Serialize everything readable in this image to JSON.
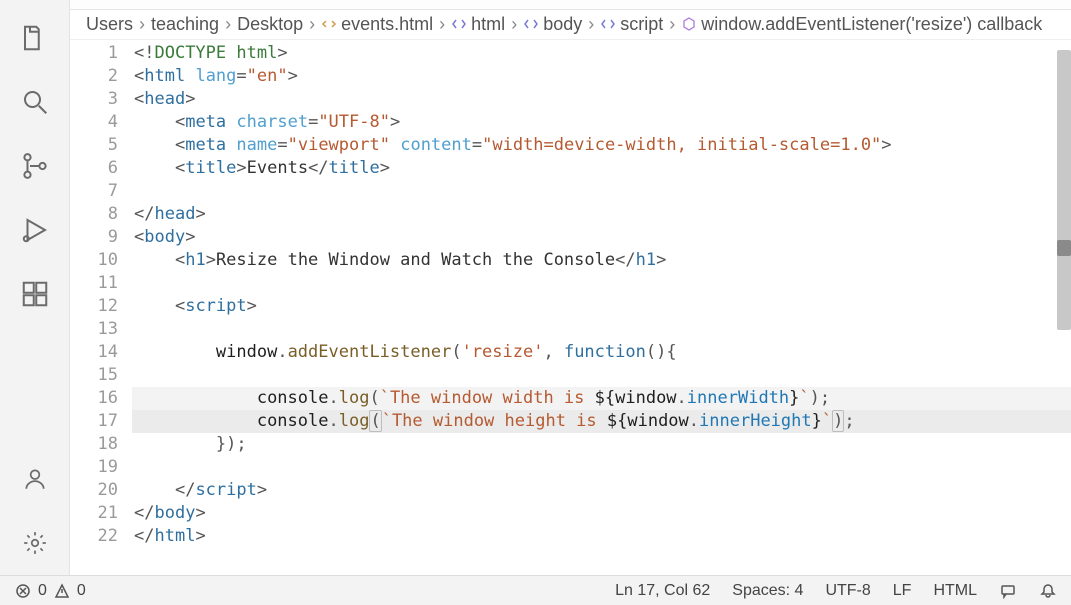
{
  "activity": {
    "icons": [
      "files",
      "search",
      "source-control",
      "run-debug",
      "extensions",
      "account",
      "settings-gear"
    ]
  },
  "breadcrumbs": {
    "items": [
      {
        "label": "Users",
        "icon": null
      },
      {
        "label": "teaching",
        "icon": null
      },
      {
        "label": "Desktop",
        "icon": null
      },
      {
        "label": "events.html",
        "icon": "file-code"
      },
      {
        "label": "html",
        "icon": "symbol"
      },
      {
        "label": "body",
        "icon": "symbol"
      },
      {
        "label": "script",
        "icon": "symbol"
      },
      {
        "label": "window.addEventListener('resize') callback",
        "icon": "symbol-cube"
      }
    ]
  },
  "code": {
    "highlight_line": 17,
    "also_highlight": [
      16
    ],
    "lines": [
      {
        "n": 1,
        "ind": 0,
        "seg": [
          [
            "punc",
            "<!"
          ],
          [
            "doctype",
            "DOCTYPE html"
          ],
          [
            "punc",
            ">"
          ]
        ]
      },
      {
        "n": 2,
        "ind": 0,
        "seg": [
          [
            "punc",
            "<"
          ],
          [
            "tag",
            "html"
          ],
          [
            "text",
            " "
          ],
          [
            "attr",
            "lang"
          ],
          [
            "punc",
            "="
          ],
          [
            "str",
            "\"en\""
          ],
          [
            "punc",
            ">"
          ]
        ]
      },
      {
        "n": 3,
        "ind": 0,
        "seg": [
          [
            "punc",
            "<"
          ],
          [
            "tag",
            "head"
          ],
          [
            "punc",
            ">"
          ]
        ]
      },
      {
        "n": 4,
        "ind": 1,
        "seg": [
          [
            "punc",
            "<"
          ],
          [
            "tag",
            "meta"
          ],
          [
            "text",
            " "
          ],
          [
            "attr",
            "charset"
          ],
          [
            "punc",
            "="
          ],
          [
            "str",
            "\"UTF-8\""
          ],
          [
            "punc",
            ">"
          ]
        ]
      },
      {
        "n": 5,
        "ind": 1,
        "seg": [
          [
            "punc",
            "<"
          ],
          [
            "tag",
            "meta"
          ],
          [
            "text",
            " "
          ],
          [
            "attr",
            "name"
          ],
          [
            "punc",
            "="
          ],
          [
            "str",
            "\"viewport\""
          ],
          [
            "text",
            " "
          ],
          [
            "attr",
            "content"
          ],
          [
            "punc",
            "="
          ],
          [
            "str",
            "\"width=device-width, initial-scale=1.0\""
          ],
          [
            "punc",
            ">"
          ]
        ]
      },
      {
        "n": 6,
        "ind": 1,
        "seg": [
          [
            "punc",
            "<"
          ],
          [
            "tag",
            "title"
          ],
          [
            "punc",
            ">"
          ],
          [
            "text",
            "Events"
          ],
          [
            "punc",
            "</"
          ],
          [
            "tag",
            "title"
          ],
          [
            "punc",
            ">"
          ]
        ]
      },
      {
        "n": 7,
        "ind": 0,
        "seg": []
      },
      {
        "n": 8,
        "ind": 0,
        "seg": [
          [
            "punc",
            "</"
          ],
          [
            "tag",
            "head"
          ],
          [
            "punc",
            ">"
          ]
        ]
      },
      {
        "n": 9,
        "ind": 0,
        "seg": [
          [
            "punc",
            "<"
          ],
          [
            "tag",
            "body"
          ],
          [
            "punc",
            ">"
          ]
        ]
      },
      {
        "n": 10,
        "ind": 1,
        "seg": [
          [
            "punc",
            "<"
          ],
          [
            "tag",
            "h1"
          ],
          [
            "punc",
            ">"
          ],
          [
            "text",
            "Resize the Window and Watch the Console"
          ],
          [
            "punc",
            "</"
          ],
          [
            "tag",
            "h1"
          ],
          [
            "punc",
            ">"
          ]
        ]
      },
      {
        "n": 11,
        "ind": 0,
        "seg": []
      },
      {
        "n": 12,
        "ind": 1,
        "seg": [
          [
            "punc",
            "<"
          ],
          [
            "tag",
            "script"
          ],
          [
            "punc",
            ">"
          ]
        ]
      },
      {
        "n": 13,
        "ind": 0,
        "seg": []
      },
      {
        "n": 14,
        "ind": 2,
        "seg": [
          [
            "ident",
            "window"
          ],
          [
            "punc",
            "."
          ],
          [
            "func",
            "addEventListener"
          ],
          [
            "punc",
            "("
          ],
          [
            "kw-resize",
            "'resize'"
          ],
          [
            "punc",
            ", "
          ],
          [
            "kw",
            "function"
          ],
          [
            "punc",
            "(){"
          ]
        ]
      },
      {
        "n": 15,
        "ind": 0,
        "seg": []
      },
      {
        "n": 16,
        "ind": 3,
        "seg": [
          [
            "ident",
            "console"
          ],
          [
            "punc",
            "."
          ],
          [
            "func",
            "log"
          ],
          [
            "punc",
            "("
          ],
          [
            "tmpl",
            "`The window width is "
          ],
          [
            "interp",
            "${"
          ],
          [
            "ident",
            "window"
          ],
          [
            "punc",
            "."
          ],
          [
            "interp-prop",
            "innerWidth"
          ],
          [
            "interp",
            "}"
          ],
          [
            "tmpl",
            "`"
          ],
          [
            "punc",
            ");"
          ]
        ]
      },
      {
        "n": 17,
        "ind": 3,
        "seg": [
          [
            "ident",
            "console"
          ],
          [
            "punc",
            "."
          ],
          [
            "func",
            "log"
          ],
          [
            "punc_m",
            "("
          ],
          [
            "tmpl",
            "`The window height is "
          ],
          [
            "interp",
            "${"
          ],
          [
            "ident",
            "window"
          ],
          [
            "punc",
            "."
          ],
          [
            "interp-prop",
            "innerHeight"
          ],
          [
            "interp",
            "}"
          ],
          [
            "tmpl",
            "`"
          ],
          [
            "punc_m",
            ")"
          ],
          [
            "punc",
            ";"
          ]
        ]
      },
      {
        "n": 18,
        "ind": 2,
        "seg": [
          [
            "punc",
            "});"
          ]
        ]
      },
      {
        "n": 19,
        "ind": 0,
        "seg": []
      },
      {
        "n": 20,
        "ind": 1,
        "seg": [
          [
            "punc",
            "</"
          ],
          [
            "tag",
            "script"
          ],
          [
            "punc",
            ">"
          ]
        ]
      },
      {
        "n": 21,
        "ind": 0,
        "seg": [
          [
            "punc",
            "</"
          ],
          [
            "tag",
            "body"
          ],
          [
            "punc",
            ">"
          ]
        ]
      },
      {
        "n": 22,
        "ind": 0,
        "seg": [
          [
            "punc",
            "</"
          ],
          [
            "tag",
            "html"
          ],
          [
            "punc",
            ">"
          ]
        ]
      }
    ]
  },
  "status": {
    "errors": "0",
    "warnings": "0",
    "cursor": "Ln 17, Col 62",
    "spaces": "Spaces: 4",
    "encoding": "UTF-8",
    "eol": "LF",
    "language": "HTML"
  }
}
